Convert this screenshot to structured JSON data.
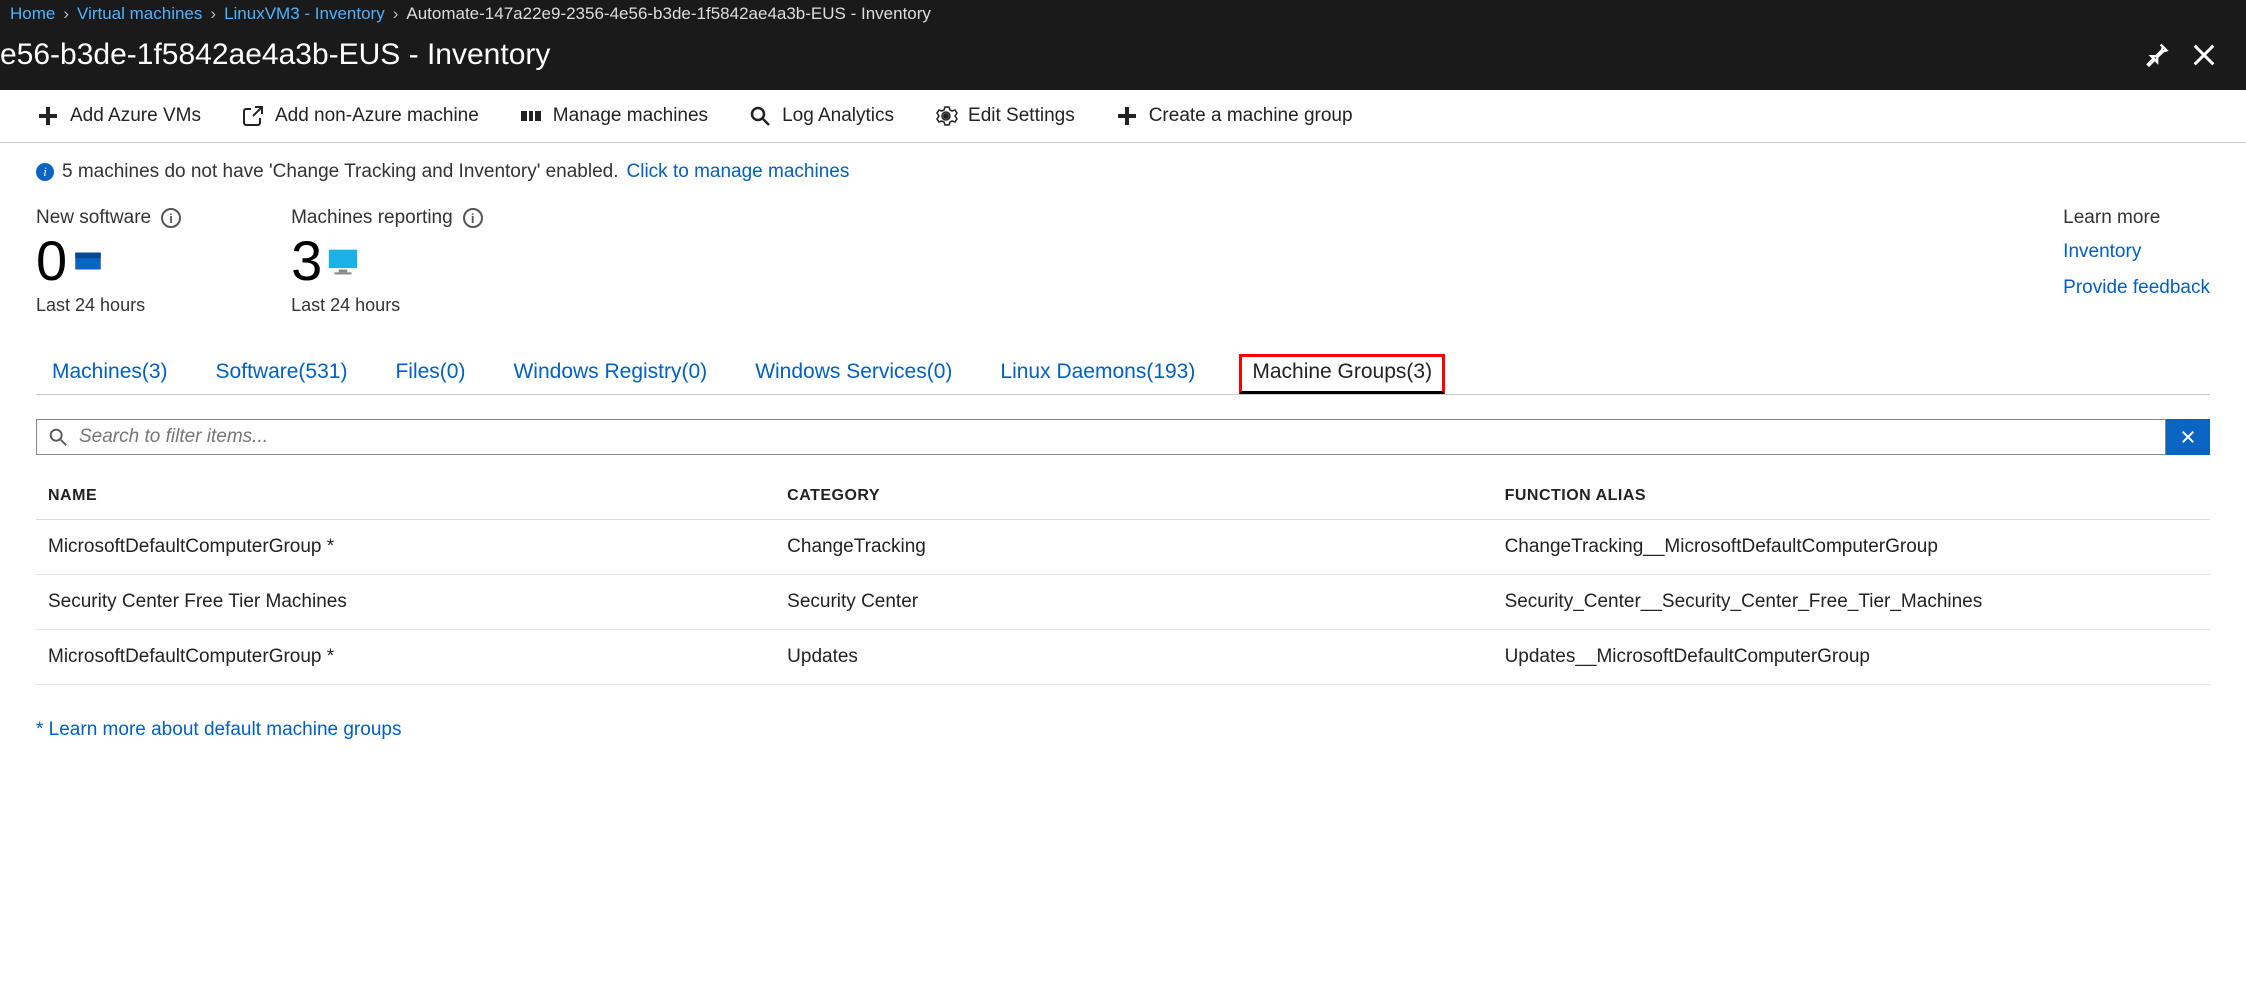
{
  "breadcrumb": {
    "home": "Home",
    "vms": "Virtual machines",
    "vm": "LinuxVM3 - Inventory",
    "current": "Automate-147a22e9-2356-4e56-b3de-1f5842ae4a3b-EUS - Inventory"
  },
  "page_title": "e56-b3de-1f5842ae4a3b-EUS - Inventory",
  "toolbar": {
    "add_azure": "Add Azure VMs",
    "add_non_azure": "Add non-Azure machine",
    "manage_machines": "Manage machines",
    "log_analytics": "Log Analytics",
    "edit_settings": "Edit Settings",
    "create_group": "Create a machine group"
  },
  "info": {
    "text": "5 machines do not have 'Change Tracking and Inventory' enabled.",
    "link": "Click to manage machines"
  },
  "stats": {
    "new_software": {
      "label": "New software",
      "value": "0",
      "sub": "Last 24 hours"
    },
    "machines_reporting": {
      "label": "Machines reporting",
      "value": "3",
      "sub": "Last 24 hours"
    }
  },
  "learn": {
    "head": "Learn more",
    "inventory": "Inventory",
    "feedback": "Provide feedback"
  },
  "tabs": {
    "machines": "Machines(3)",
    "software": "Software(531)",
    "files": "Files(0)",
    "registry": "Windows Registry(0)",
    "services": "Windows Services(0)",
    "daemons": "Linux Daemons(193)",
    "groups": "Machine Groups(3)"
  },
  "search": {
    "placeholder": "Search to filter items..."
  },
  "table": {
    "headers": {
      "name": "NAME",
      "category": "CATEGORY",
      "alias": "FUNCTION ALIAS"
    },
    "rows": [
      {
        "name": "MicrosoftDefaultComputerGroup *",
        "category": "ChangeTracking",
        "alias": "ChangeTracking__MicrosoftDefaultComputerGroup"
      },
      {
        "name": "Security Center Free Tier Machines",
        "category": "Security Center",
        "alias": "Security_Center__Security_Center_Free_Tier_Machines"
      },
      {
        "name": "MicrosoftDefaultComputerGroup *",
        "category": "Updates",
        "alias": "Updates__MicrosoftDefaultComputerGroup"
      }
    ]
  },
  "footer": {
    "link": "* Learn more about default machine groups"
  }
}
